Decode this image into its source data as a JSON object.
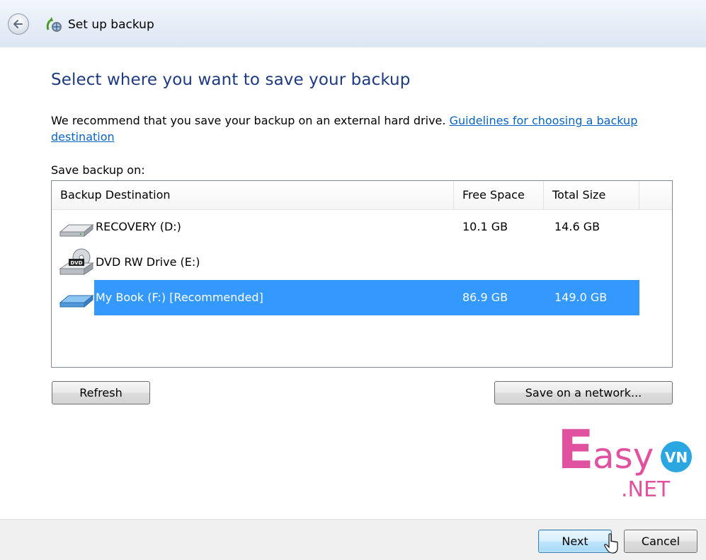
{
  "window": {
    "title": "Set up backup",
    "back_icon": "back-arrow-icon",
    "app_icon": "backup-icon"
  },
  "main": {
    "heading": "Select where you want to save your backup",
    "description": "We recommend that you save your backup on an external hard drive.",
    "guidelines_link": "Guidelines for choosing a backup destination",
    "save_label": "Save backup on:"
  },
  "table": {
    "columns": [
      "Backup Destination",
      "Free Space",
      "Total Size"
    ],
    "rows": [
      {
        "name": "RECOVERY (D:)",
        "free": "10.1 GB",
        "total": "14.6 GB",
        "icon": "hard-drive-icon",
        "selected": false
      },
      {
        "name": "DVD RW Drive (E:)",
        "free": "",
        "total": "",
        "icon": "dvd-drive-icon",
        "selected": false
      },
      {
        "name": "My Book (F:) [Recommended]",
        "free": "86.9 GB",
        "total": "149.0 GB",
        "icon": "external-drive-icon",
        "selected": true
      }
    ]
  },
  "buttons": {
    "refresh": "Refresh",
    "save_network": "Save on a network...",
    "next": "Next",
    "cancel": "Cancel"
  },
  "watermark": {
    "text_main": "Easy",
    "text_sub": ".NET",
    "badge": "VN"
  },
  "colors": {
    "heading": "#1e3b82",
    "link": "#0a64c2",
    "selection": "#3399ff",
    "watermark_pink": "#e0519f",
    "watermark_blue": "#2aa7e0"
  }
}
